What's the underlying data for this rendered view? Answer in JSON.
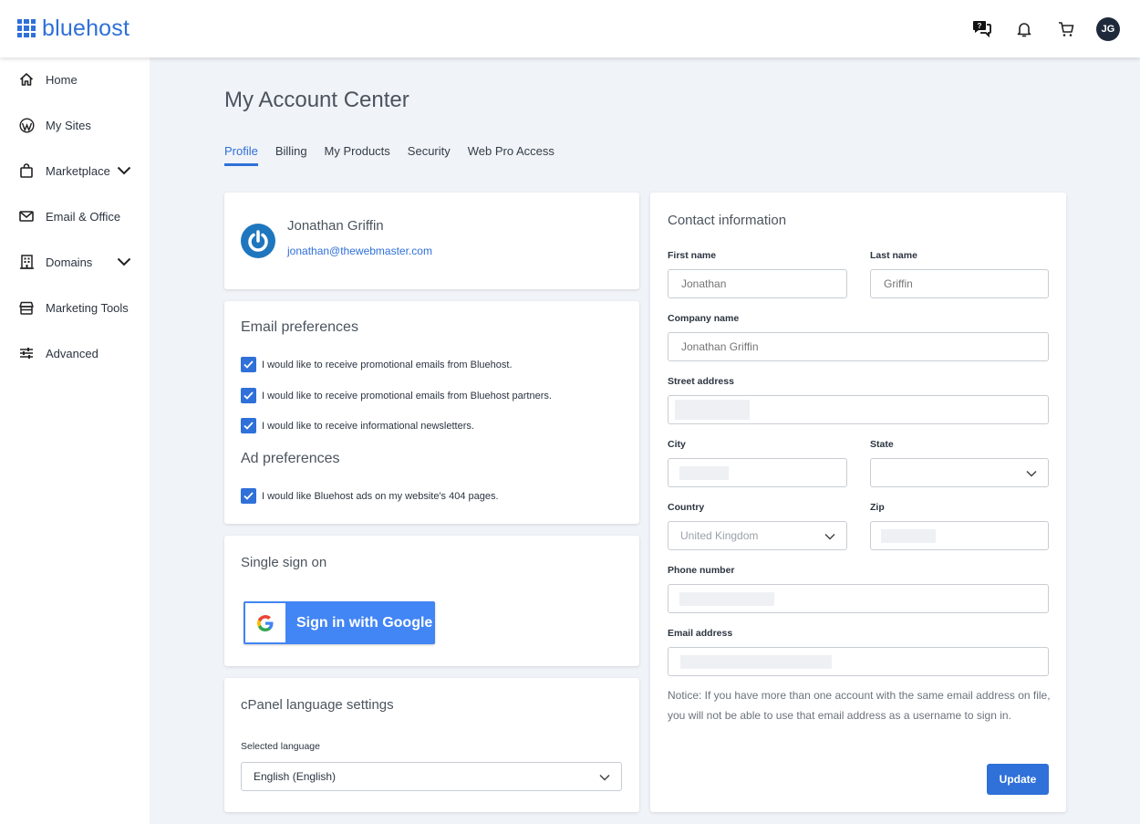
{
  "brand": {
    "name": "bluehost",
    "color": "#2f70d9"
  },
  "header": {
    "icons": [
      "help-chat-icon",
      "bell-icon",
      "cart-icon"
    ],
    "avatar_initials": "JG"
  },
  "sidebar": {
    "items": [
      {
        "label": "Home",
        "icon": "home-icon",
        "expandable": false
      },
      {
        "label": "My Sites",
        "icon": "wordpress-icon",
        "expandable": false
      },
      {
        "label": "Marketplace",
        "icon": "shopping-bag-icon",
        "expandable": true
      },
      {
        "label": "Email & Office",
        "icon": "envelope-icon",
        "expandable": false
      },
      {
        "label": "Domains",
        "icon": "building-icon",
        "expandable": true
      },
      {
        "label": "Marketing Tools",
        "icon": "storefront-icon",
        "expandable": false
      },
      {
        "label": "Advanced",
        "icon": "sliders-icon",
        "expandable": false
      }
    ]
  },
  "page": {
    "title": "My Account Center",
    "tabs": [
      {
        "label": "Profile",
        "active": true
      },
      {
        "label": "Billing",
        "active": false
      },
      {
        "label": "My Products",
        "active": false
      },
      {
        "label": "Security",
        "active": false
      },
      {
        "label": "Web Pro Access",
        "active": false
      }
    ]
  },
  "profile": {
    "name": "Jonathan Griffin",
    "email": "jonathan@thewebmaster.com"
  },
  "email_preferences": {
    "title": "Email preferences",
    "options": [
      {
        "label": "I would like to receive promotional emails from Bluehost.",
        "checked": true
      },
      {
        "label": "I would like to receive promotional emails from Bluehost partners.",
        "checked": true
      },
      {
        "label": "I would like to receive informational newsletters.",
        "checked": true
      }
    ]
  },
  "ad_preferences": {
    "title": "Ad preferences",
    "options": [
      {
        "label": "I would like Bluehost ads on my website's 404 pages.",
        "checked": true
      }
    ]
  },
  "sso": {
    "title": "Single sign on",
    "google_button": "Sign in with Google"
  },
  "cpanel": {
    "title": "cPanel language settings",
    "label": "Selected language",
    "value": "English (English)"
  },
  "contact": {
    "title": "Contact information",
    "first_name": {
      "label": "First name",
      "placeholder": "Jonathan"
    },
    "last_name": {
      "label": "Last name",
      "placeholder": "Griffin"
    },
    "company": {
      "label": "Company name",
      "placeholder": "Jonathan Griffin"
    },
    "street": {
      "label": "Street address"
    },
    "city": {
      "label": "City"
    },
    "state": {
      "label": "State",
      "value": ""
    },
    "country": {
      "label": "Country",
      "value": "United Kingdom"
    },
    "zip": {
      "label": "Zip"
    },
    "phone": {
      "label": "Phone number"
    },
    "email": {
      "label": "Email address"
    },
    "notice": "Notice: If you have more than one account with the same email address on file, you will not be able to use that email address as a username to sign in.",
    "update_button": "Update"
  }
}
